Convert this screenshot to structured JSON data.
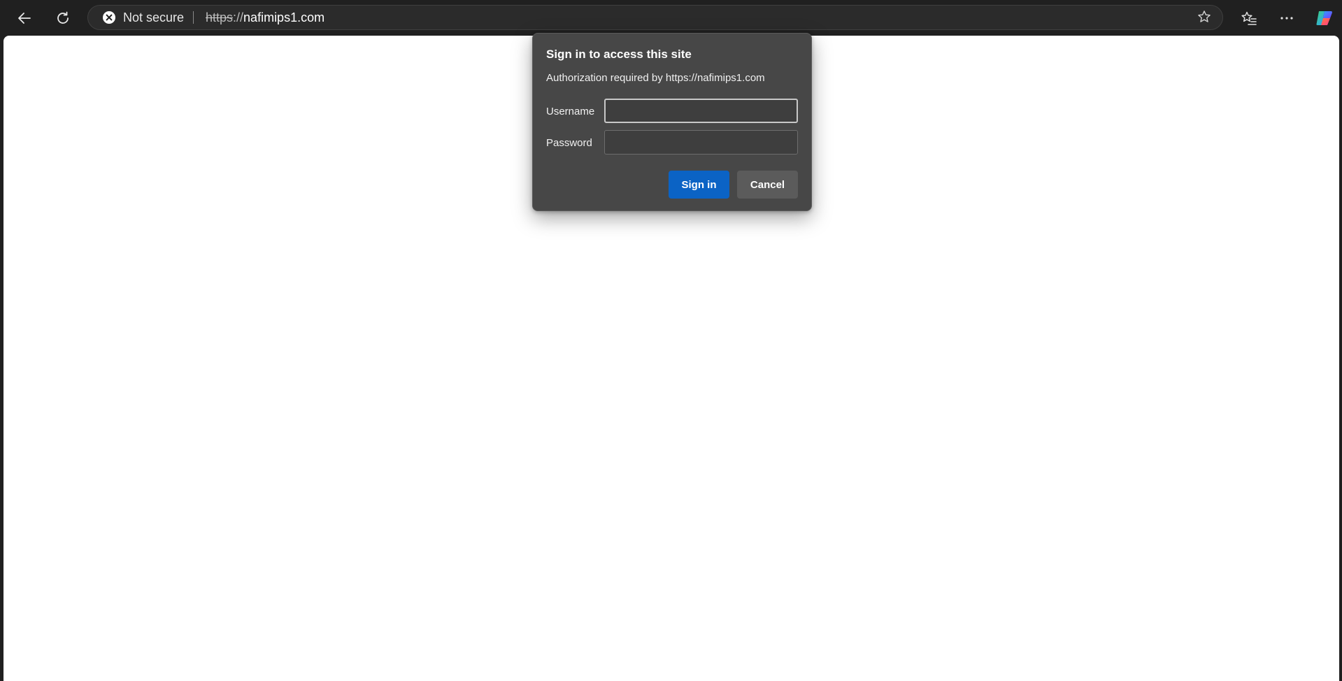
{
  "browser": {
    "toolbar": {
      "back_icon": "back-arrow-icon",
      "refresh_icon": "refresh-icon",
      "favorites_icon": "favorites-list-icon",
      "more_icon": "more-horizontal-icon",
      "copilot_icon": "copilot-icon"
    },
    "address_bar": {
      "security_label": "Not secure",
      "security_icon": "not-secure-x-icon",
      "url_scheme": "https",
      "url_separator": "://",
      "url_host": "nafimips1.com",
      "star_icon": "add-favorite-star-icon"
    }
  },
  "dialog": {
    "title": "Sign in to access this site",
    "subtitle": "Authorization required by https://nafimips1.com",
    "username_label": "Username",
    "username_value": "",
    "password_label": "Password",
    "password_value": "",
    "sign_in_label": "Sign in",
    "cancel_label": "Cancel"
  },
  "colors": {
    "toolbar_bg": "#202020",
    "dialog_bg": "#474747",
    "primary_button": "#0b63c5",
    "secondary_button": "#5b5b5b",
    "page_bg": "#ffffff"
  }
}
